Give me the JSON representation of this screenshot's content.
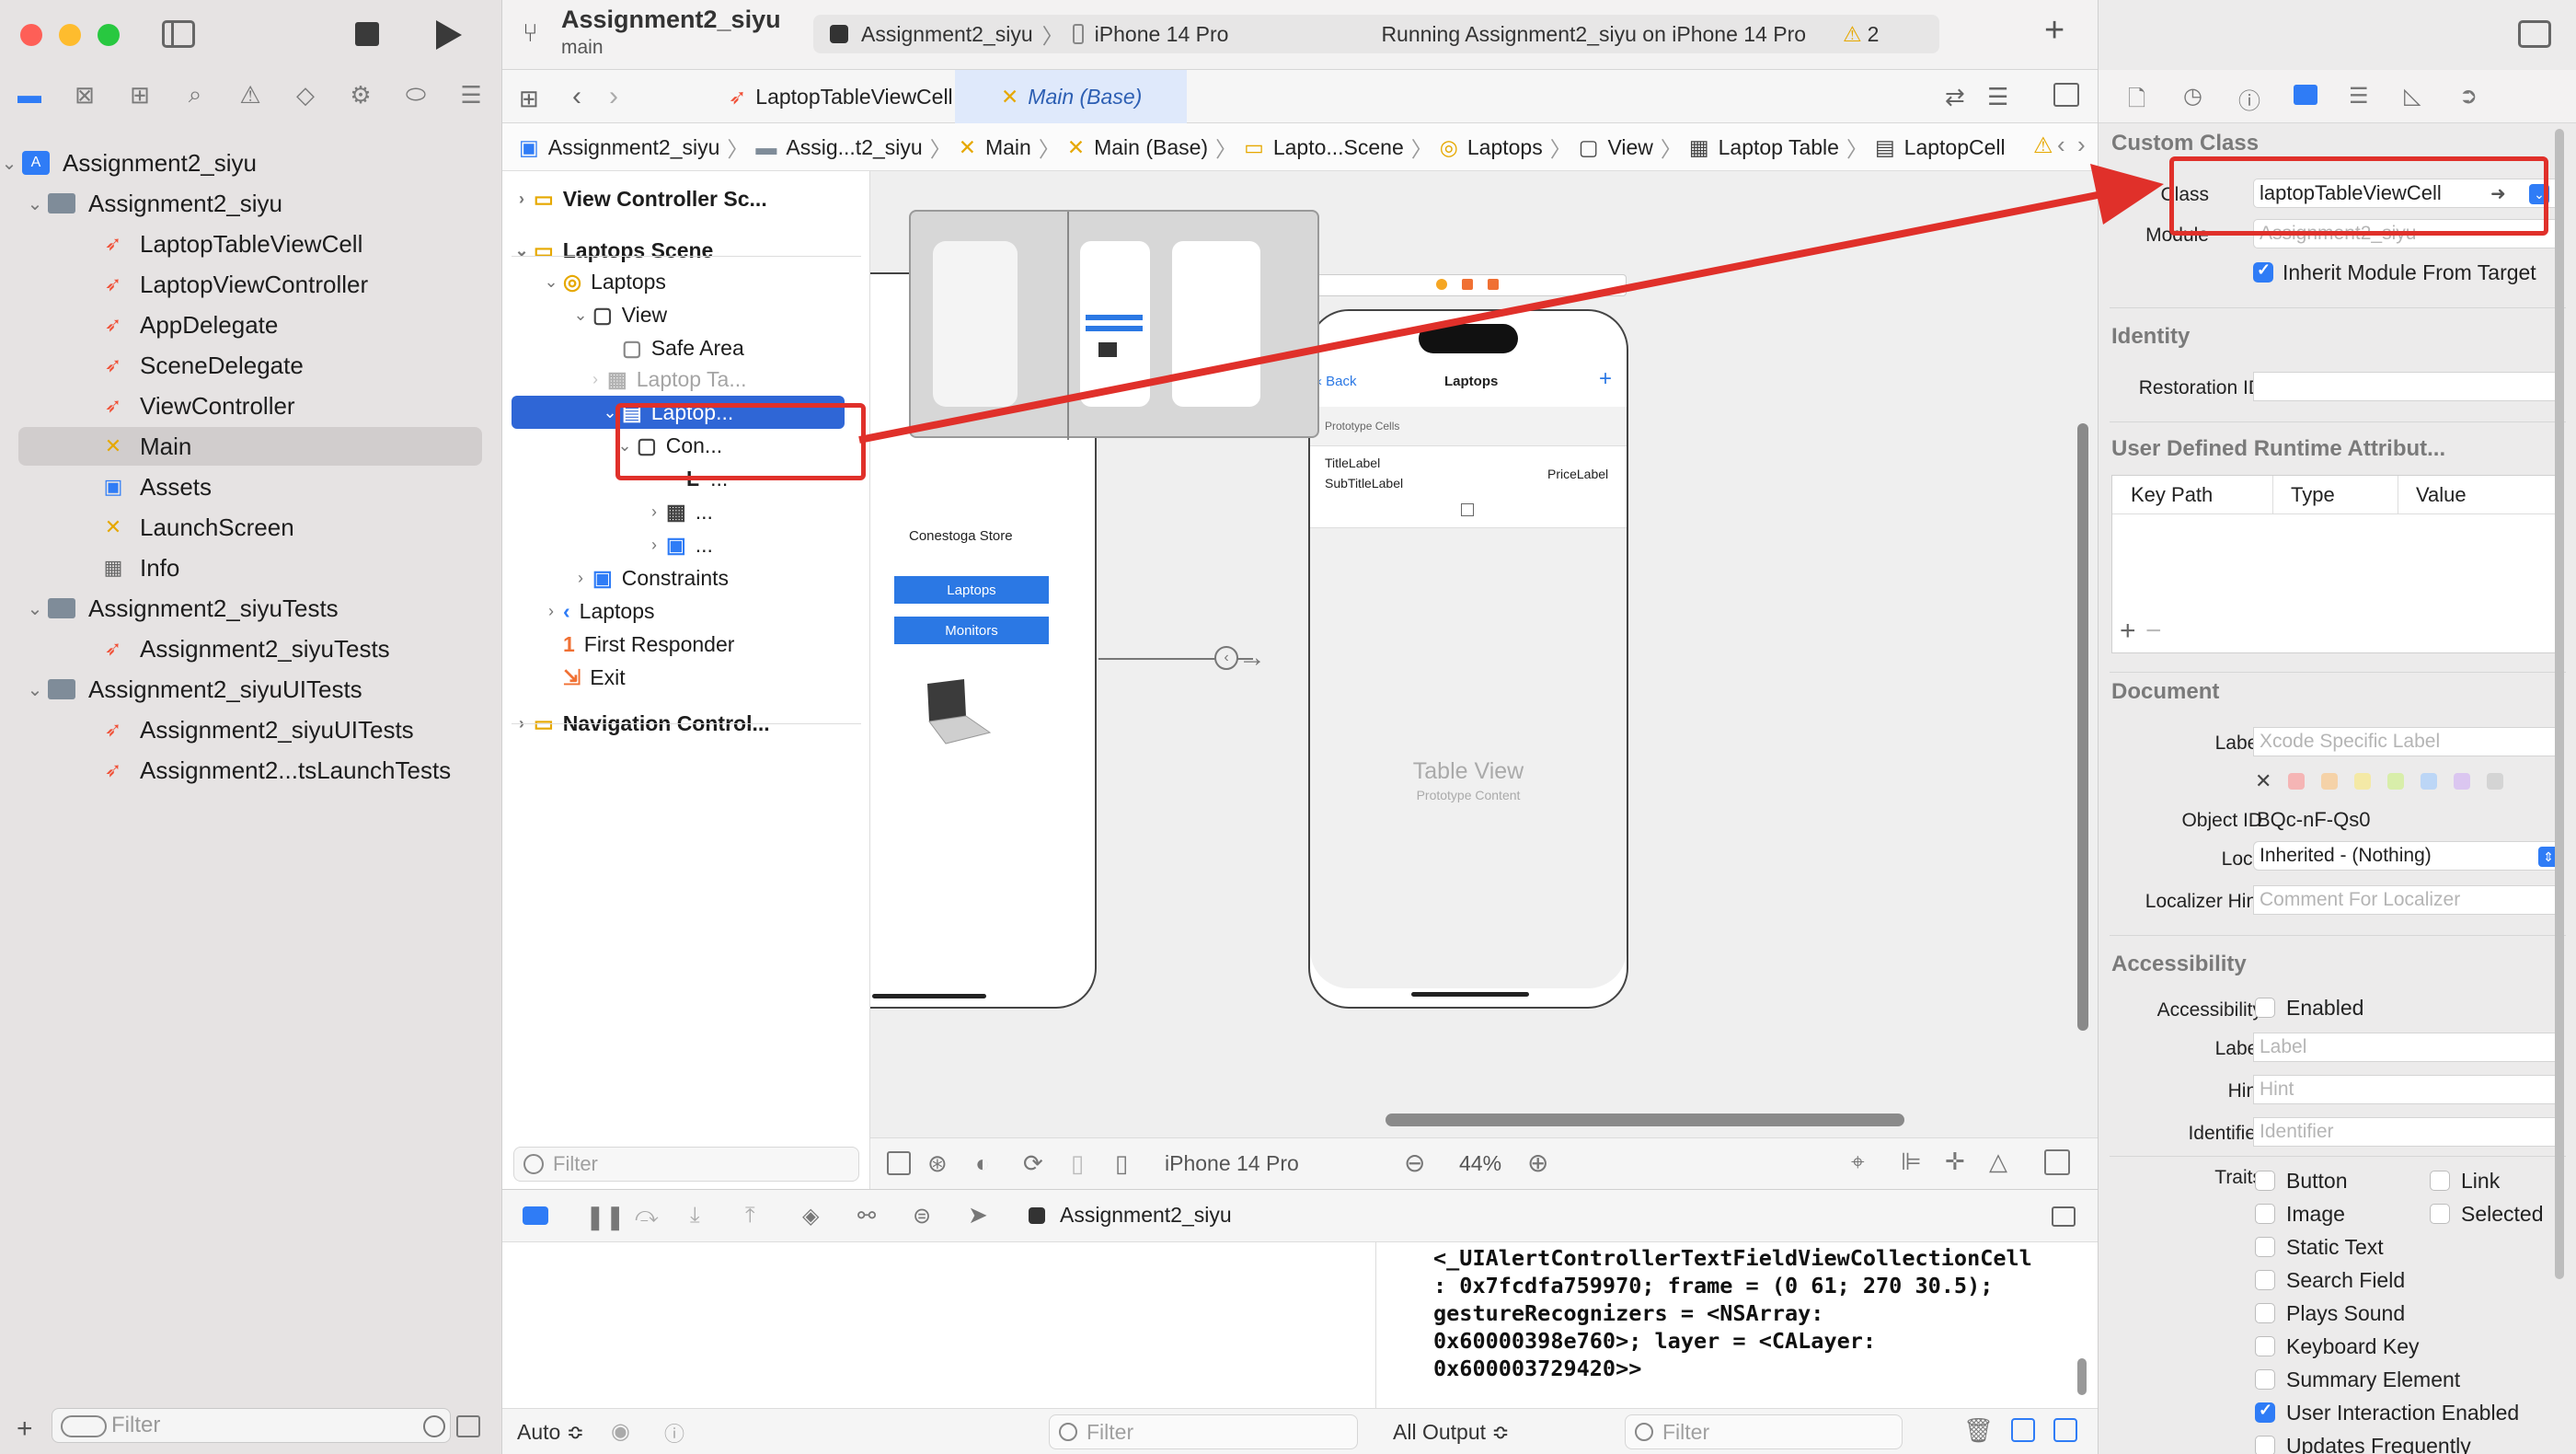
{
  "window": {
    "project_name": "Assignment2_siyu",
    "branch": "main",
    "scheme": "Assignment2_siyu",
    "device": "iPhone 14 Pro",
    "status": "Running Assignment2_siyu on iPhone 14 Pro",
    "warning_count": "2"
  },
  "navigator": {
    "items": [
      {
        "label": "Assignment2_siyu",
        "kind": "project"
      },
      {
        "label": "Assignment2_siyu",
        "kind": "folder"
      },
      {
        "label": "LaptopTableViewCell",
        "kind": "swift"
      },
      {
        "label": "LaptopViewController",
        "kind": "swift"
      },
      {
        "label": "AppDelegate",
        "kind": "swift"
      },
      {
        "label": "SceneDelegate",
        "kind": "swift"
      },
      {
        "label": "ViewController",
        "kind": "swift"
      },
      {
        "label": "Main",
        "kind": "storyboard"
      },
      {
        "label": "Assets",
        "kind": "assets"
      },
      {
        "label": "LaunchScreen",
        "kind": "storyboard"
      },
      {
        "label": "Info",
        "kind": "plist"
      },
      {
        "label": "Assignment2_siyuTests",
        "kind": "folder"
      },
      {
        "label": "Assignment2_siyuTests",
        "kind": "swift"
      },
      {
        "label": "Assignment2_siyuUITests",
        "kind": "folder"
      },
      {
        "label": "Assignment2_siyuUITests",
        "kind": "swift"
      },
      {
        "label": "Assignment2...tsLaunchTests",
        "kind": "swift"
      }
    ],
    "filter_placeholder": "Filter"
  },
  "tabs": [
    {
      "label": "LaptopTableViewCell",
      "active": false
    },
    {
      "label": "Main (Base)",
      "active": true
    }
  ],
  "jumpbar": [
    "Assignment2_siyu",
    "Assig...t2_siyu",
    "Main",
    "Main (Base)",
    "Lapto...Scene",
    "Laptops",
    "View",
    "Laptop Table",
    "LaptopCell"
  ],
  "outline": {
    "items": [
      "View Controller Sc...",
      "Laptops Scene",
      "Laptops",
      "View",
      "Safe Area",
      "Laptop Ta...",
      "Laptop...",
      "Con...",
      "L",
      "...",
      "...",
      "...",
      "Constraints",
      "Laptops",
      "First Responder",
      "Exit",
      "Navigation Control..."
    ],
    "filter_placeholder": "Filter"
  },
  "canvas": {
    "store_title": "Conestoga Store",
    "btn_laptops": "Laptops",
    "btn_monitors": "Monitors",
    "nav_back": "Back",
    "nav_title": "Laptops",
    "nav_add": "+",
    "prototype_cells": "Prototype Cells",
    "title_label": "TitleLabel",
    "subtitle_label": "SubTitleLabel",
    "price_label": "PriceLabel",
    "table_view": "Table View",
    "prototype_content": "Prototype Content",
    "device": "iPhone 14 Pro",
    "zoom": "44%"
  },
  "debug": {
    "scheme": "Assignment2_siyu",
    "auto_label": "Auto ≎",
    "output_label": "All Output ≎",
    "filter_placeholder": "Filter",
    "console_text": "<_UIAlertControllerTextFieldViewCollectionCell\n: 0x7fcdfa759970; frame = (0 61; 270 30.5);\ngestureRecognizers = <NSArray:\n0x60000398e760>; layer = <CALayer:\n0x600003729420>>"
  },
  "inspector": {
    "custom_class": {
      "title": "Custom Class",
      "class_label": "Class",
      "class_value": "laptopTableViewCell",
      "module_label": "Module",
      "module_value": "Assignment2_siyu",
      "inherit_label": "Inherit Module From Target"
    },
    "identity": {
      "title": "Identity",
      "restoration_label": "Restoration ID"
    },
    "runtime": {
      "title": "User Defined Runtime Attribut...",
      "col_key": "Key Path",
      "col_type": "Type",
      "col_value": "Value"
    },
    "document": {
      "title": "Document",
      "label_label": "Label",
      "label_placeholder": "Xcode Specific Label",
      "objectid_label": "Object ID",
      "objectid_value": "BQc-nF-Qs0",
      "lock_label": "Lock",
      "lock_value": "Inherited - (Nothing)",
      "hint_label": "Localizer Hint",
      "hint_placeholder": "Comment For Localizer"
    },
    "accessibility": {
      "title": "Accessibility",
      "acc_label": "Accessibility",
      "enabled": "Enabled",
      "label_label": "Label",
      "label_placeholder": "Label",
      "hint_label": "Hint",
      "hint_placeholder": "Hint",
      "identifier_label": "Identifier",
      "identifier_placeholder": "Identifier",
      "traits_label": "Traits",
      "traits": [
        "Button",
        "Link",
        "Image",
        "Selected",
        "Static Text",
        "Search Field",
        "Plays Sound",
        "Keyboard Key",
        "Summary Element",
        "User Interaction Enabled",
        "Updates Frequently"
      ]
    }
  },
  "colors": {
    "accent": "#2f7cf6",
    "annotation_red": "#e0302a",
    "swift_orange": "#f05138"
  }
}
